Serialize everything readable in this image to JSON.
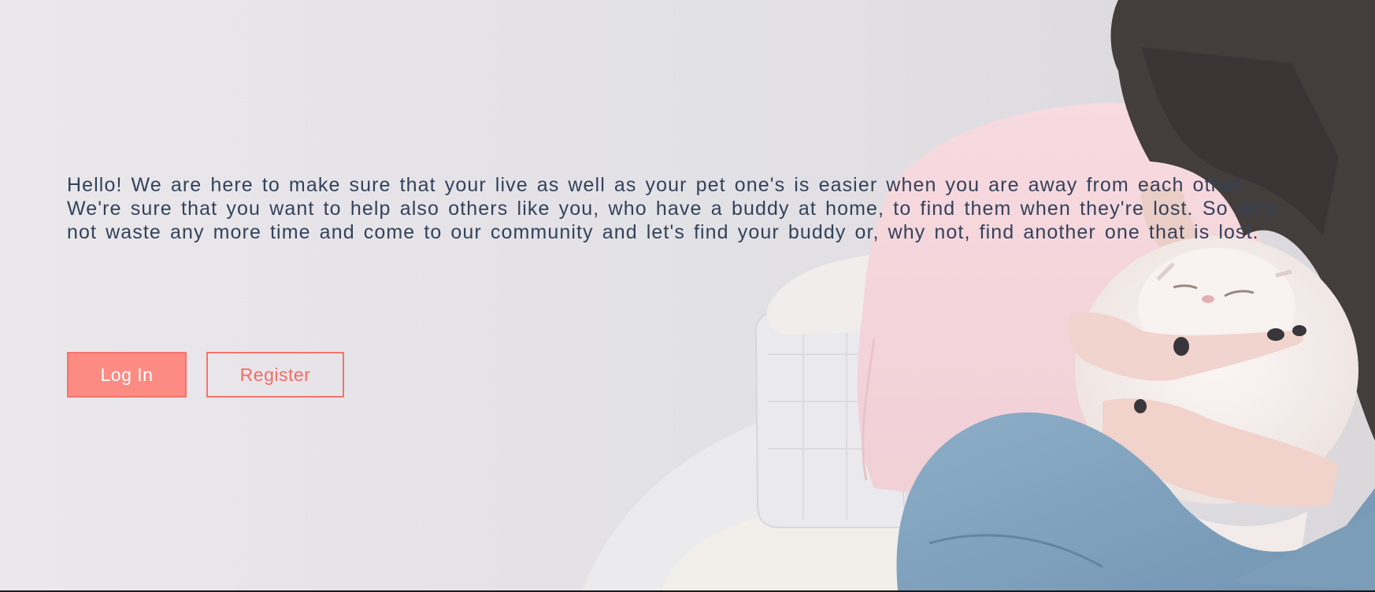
{
  "hero": {
    "paragraphs": [
      "Hello! We are here to make sure that your live as well as your pet one's is easier when you are away from each other.",
      "We're sure that you want to help also others like you, who have a buddy at home, to find them when they're lost. So let's not waste any more time and come to our community and let's find your buddy or, why not, find another one that is lost."
    ],
    "login_label": "Log In",
    "register_label": "Register"
  },
  "colors": {
    "accent": "#fc8b83",
    "accent_border": "#f4736b",
    "text": "#34425a",
    "background": "#e2e0e4"
  },
  "image": {
    "description_icon": "woman-holding-white-cat-photo"
  }
}
